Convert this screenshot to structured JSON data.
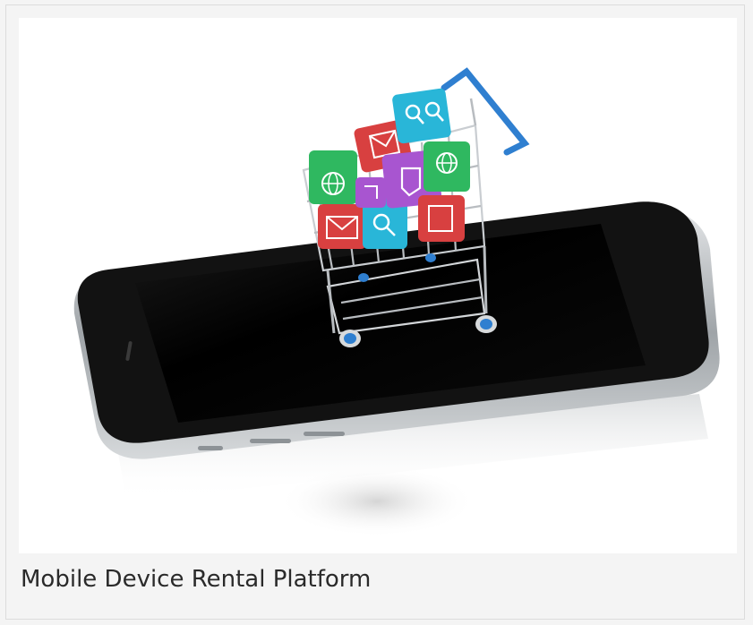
{
  "card": {
    "caption": "Mobile Device Rental Platform"
  },
  "illustration": {
    "subject": "smartphone-with-shopping-cart",
    "icons": [
      "globe-icon",
      "mail-icon",
      "search-icon",
      "document-icon",
      "phone-icon"
    ],
    "colors": {
      "background": "#ffffff",
      "phone_screen": "#050505",
      "phone_frame": "#bfc3c6",
      "cart_handle": "#2f7fd0",
      "cube_green": "#2fb860",
      "cube_red": "#d84040",
      "cube_cyan": "#29b6d8",
      "cube_purple": "#a855d0"
    }
  }
}
